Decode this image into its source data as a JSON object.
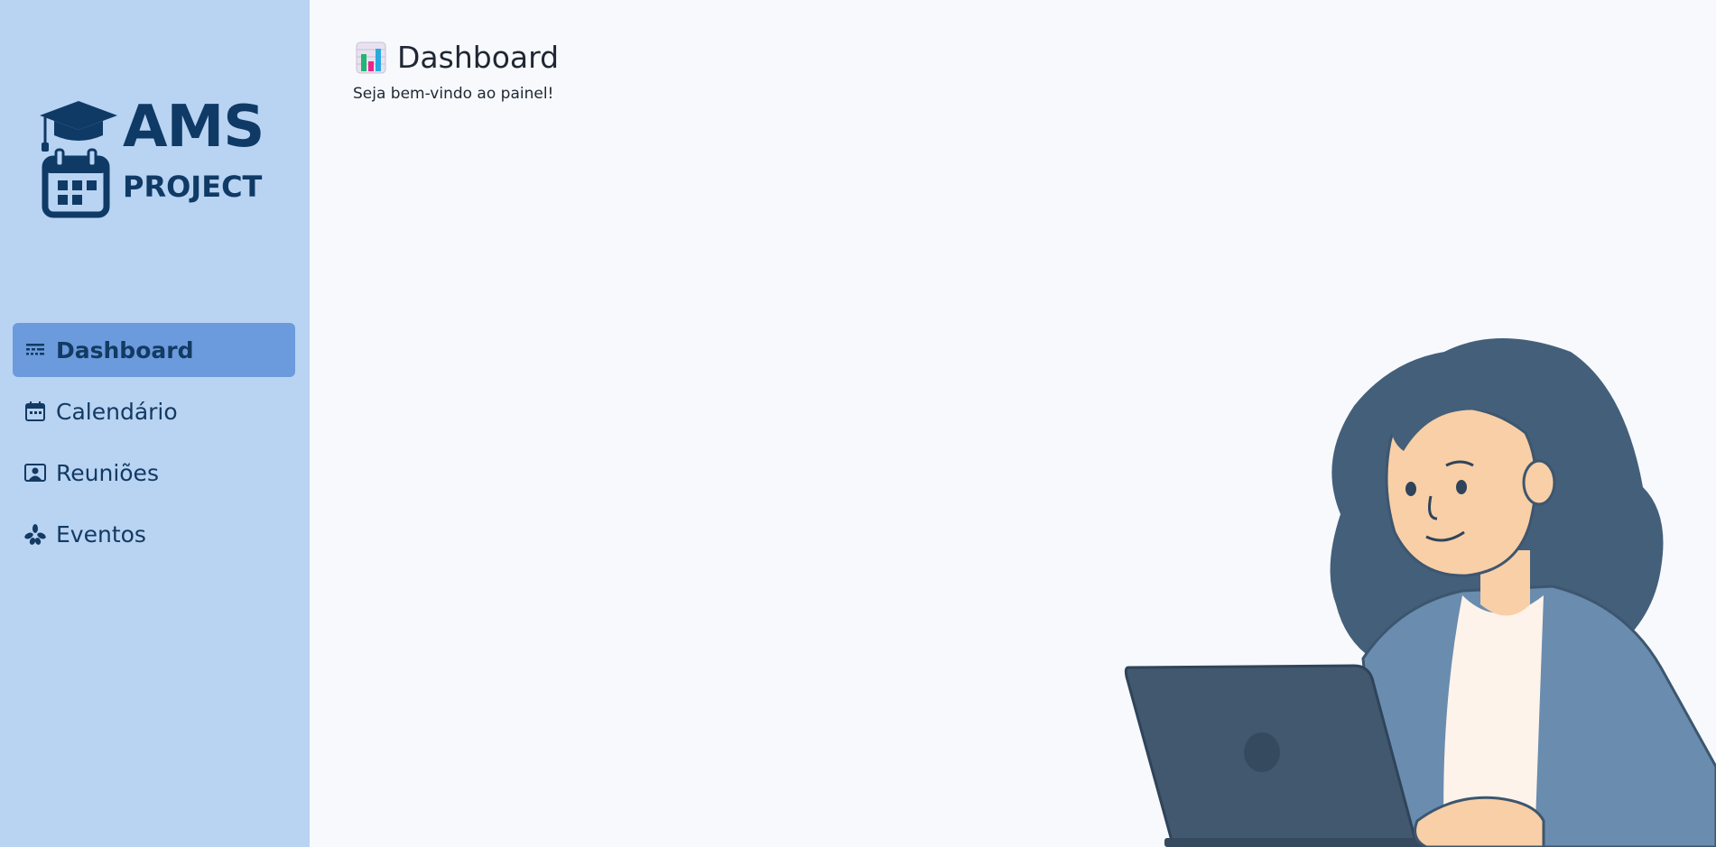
{
  "logo": {
    "line1": "AMS",
    "line2": "PROJECT"
  },
  "nav": {
    "items": [
      {
        "label": "Dashboard",
        "icon": "dashboard-icon",
        "active": true
      },
      {
        "label": "Calendário",
        "icon": "calendar-icon",
        "active": false
      },
      {
        "label": "Reuniões",
        "icon": "meeting-icon",
        "active": false
      },
      {
        "label": "Eventos",
        "icon": "events-icon",
        "active": false
      }
    ]
  },
  "main": {
    "title": "Dashboard",
    "title_icon": "bar-chart-icon",
    "subtitle": "Seja bem-vindo ao painel!"
  },
  "colors": {
    "sidebar_bg": "#b9d3f2",
    "active_item_bg": "#6b9bdc",
    "brand_dark": "#0f3a66",
    "page_bg": "#f7f9fc"
  }
}
